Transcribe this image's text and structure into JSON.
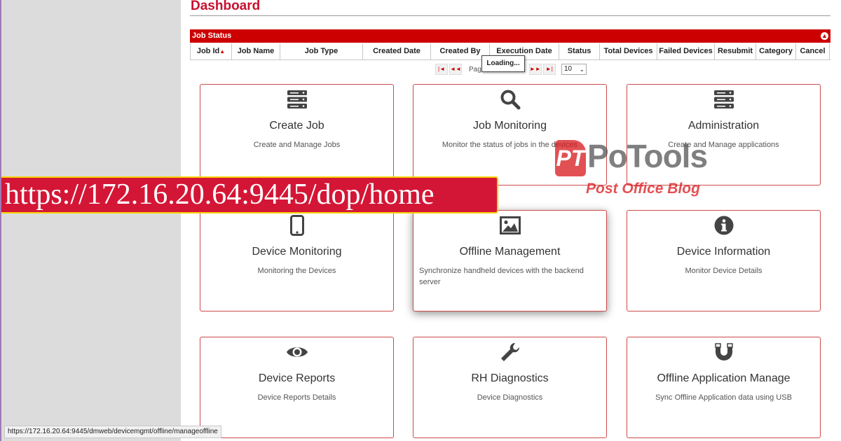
{
  "page": {
    "title": "Dashboard"
  },
  "job_status": {
    "label": "Job Status",
    "collapse_symbol": "▲",
    "columns": [
      "Job Id",
      "Job Name",
      "Job Type",
      "Created Date",
      "Created By",
      "Execution Date",
      "Status",
      "Total Devices",
      "Failed Devices",
      "Resubmit",
      "Category",
      "Cancel"
    ],
    "pager": {
      "page_label": "Pag",
      "page_size": "10",
      "first": "|◄",
      "prev": "◄◄",
      "next": "►►",
      "last": "►|"
    },
    "loading_text": "Loading..."
  },
  "cards": [
    {
      "title": "Create Job",
      "desc": "Create and Manage Jobs",
      "icon": "server-stack-icon"
    },
    {
      "title": "Job Monitoring",
      "desc": "Monitor the status of jobs in the devices",
      "icon": "search-icon"
    },
    {
      "title": "Administration",
      "desc": "Create and Manage applications",
      "icon": "server-stack-icon"
    },
    {
      "title": "Device Monitoring",
      "desc": "Monitoring the Devices",
      "icon": "mobile-phone-icon"
    },
    {
      "title": "Offline Management",
      "desc": "Synchronize handheld devices with the backend server",
      "icon": "image-icon"
    },
    {
      "title": "Device Information",
      "desc": "Monitor Device Details",
      "icon": "info-circle-icon"
    },
    {
      "title": "Device Reports",
      "desc": "Device Reports Details",
      "icon": "eye-icon"
    },
    {
      "title": "RH Diagnostics",
      "desc": "Device Diagnostics",
      "icon": "wrench-icon"
    },
    {
      "title": "Offline Application Manage",
      "desc": "Sync Offline Application data using USB",
      "icon": "magnet-icon"
    }
  ],
  "overlay": {
    "url_banner": "https://172.16.20.64:9445/dop/home",
    "watermark_logo": "PT",
    "watermark_title": "PoTools",
    "watermark_subtitle": "Post Office Blog"
  },
  "status_bar": {
    "url": "https://172.16.20.64:9445/dmweb/devicemgmt/offline/manageoffline"
  },
  "colors": {
    "accent": "#cc0000",
    "card_border": "#cc4b4b",
    "banner_bg": "#d41636",
    "banner_border": "#f6d000"
  }
}
